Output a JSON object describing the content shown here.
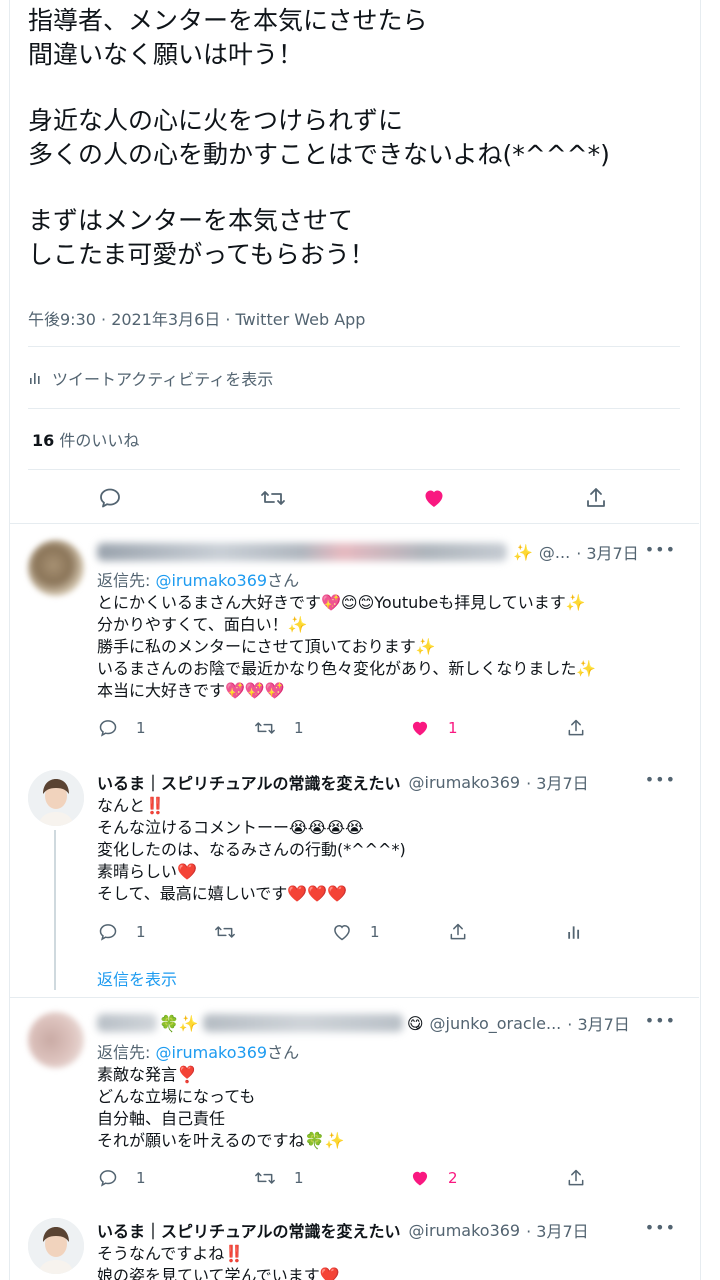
{
  "main_tweet": {
    "paragraphs": [
      "指導者、メンターを本気にさせたら\n間違いなく願いは叶う！",
      "身近な人の心に火をつけられずに\n多くの人の心を動かすことはできないよね(*^^^*)",
      "まずはメンターを本気させて\nしこたま可愛がってもらおう！"
    ],
    "timestamp": "午後9:30 · 2021年3月6日 · Twitter Web App",
    "activity_label": "ツイートアクティビティを表示",
    "likes_count": "16",
    "likes_label": " 件のいいね"
  },
  "replies": [
    {
      "handle": "@...",
      "date": "· 3月7日",
      "reply_to_prefix": "返信先: ",
      "reply_to_handle": "@irumako369",
      "reply_to_suffix": "さん",
      "text": "とにかくいるまさん大好きです💖😊😊Youtubeも拝見しています✨\n分かりやすくて、面白い！✨\n勝手に私のメンターにさせて頂いております✨\nいるまさんのお陰で最近かなり色々変化があり、新しくなりました✨\n本当に大好きです💖💖💖",
      "reply_count": "1",
      "retweet_count": "1",
      "like_count": "1"
    },
    {
      "name": "いるま｜スピリチュアルの常識を変えたい",
      "handle": "@irumako369",
      "date": "· 3月7日",
      "text": "なんと‼️\nそんな泣けるコメントーー😭😭😭😭\n変化したのは、なるみさんの行動(*^^^*)\n素晴らしい❤️\nそして、最高に嬉しいです❤️❤️❤️",
      "reply_count": "1",
      "like_count": "1",
      "show_replies": "返信を表示"
    },
    {
      "handle": "@junko_oracle...",
      "date": "· 3月7日",
      "reply_to_prefix": "返信先: ",
      "reply_to_handle": "@irumako369",
      "reply_to_suffix": "さん",
      "text": "素敵な発言❣️\nどんな立場になっても\n自分軸、自己責任\nそれが願いを叶えるのですね🍀✨",
      "reply_count": "1",
      "retweet_count": "1",
      "like_count": "2"
    },
    {
      "name": "いるま｜スピリチュアルの常識を変えたい",
      "handle": "@irumako369",
      "date": "· 3月7日",
      "text": "そうなんですよね‼️\n娘の姿を見ていて学んでいます❤️"
    }
  ],
  "colors": {
    "like_red": "#f91880",
    "link_blue": "#1d9bf0",
    "muted": "#536471"
  },
  "icons": [
    "reply-icon",
    "retweet-icon",
    "heart-icon",
    "share-icon",
    "analytics-icon",
    "more-icon"
  ]
}
